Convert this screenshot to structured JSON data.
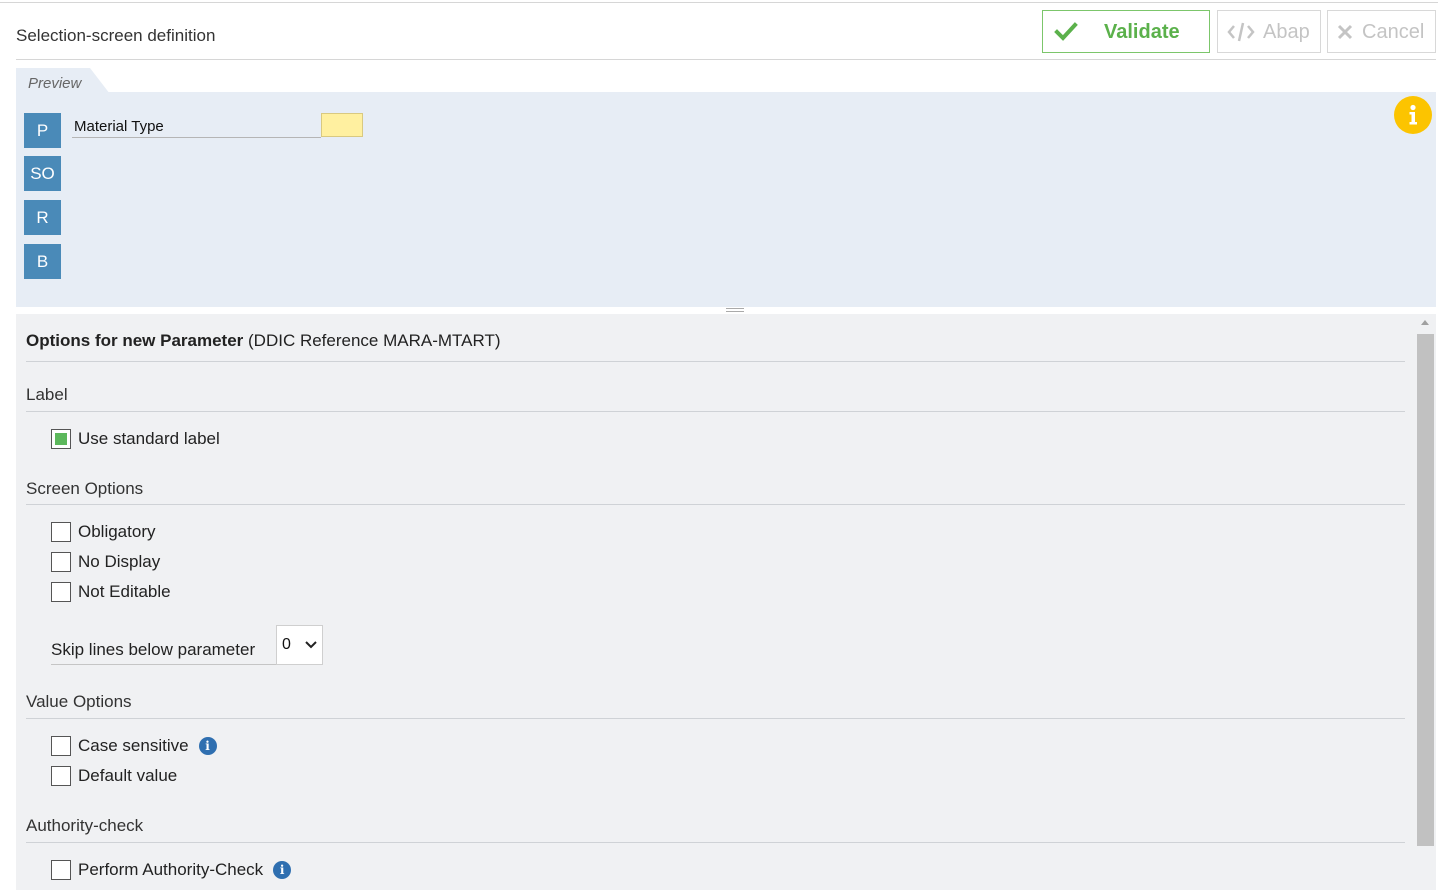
{
  "header": {
    "title": "Selection-screen definition",
    "buttons": {
      "validate": "Validate",
      "abap": "Abap",
      "cancel": "Cancel"
    }
  },
  "colors": {
    "validate": "#5bb14b",
    "disabled": "#c4c4c4",
    "preview_bg": "#e7edf5",
    "param_button": "#4a8ab8",
    "info": "#fcc400"
  },
  "preview": {
    "tab_label": "Preview",
    "side_buttons": [
      "P",
      "SO",
      "R",
      "B"
    ],
    "field_label": "Material Type",
    "info_icon": "info-icon"
  },
  "options": {
    "title_bold": "Options for new Parameter",
    "title_rest": " (DDIC Reference MARA-MTART)",
    "sections": {
      "label": {
        "heading": "Label",
        "use_standard_label": {
          "label": "Use standard label",
          "checked": true
        }
      },
      "screen": {
        "heading": "Screen Options",
        "obligatory": {
          "label": "Obligatory",
          "checked": false
        },
        "no_display": {
          "label": "No Display",
          "checked": false
        },
        "not_editable": {
          "label": "Not Editable",
          "checked": false
        },
        "skip_lines": {
          "label": "Skip lines below parameter",
          "value": "0"
        }
      },
      "value": {
        "heading": "Value Options",
        "case_sensitive": {
          "label": "Case sensitive",
          "checked": false
        },
        "default_value": {
          "label": "Default value",
          "checked": false
        }
      },
      "authority": {
        "heading": "Authority-check",
        "perform": {
          "label": "Perform Authority-Check",
          "checked": false
        }
      }
    }
  }
}
